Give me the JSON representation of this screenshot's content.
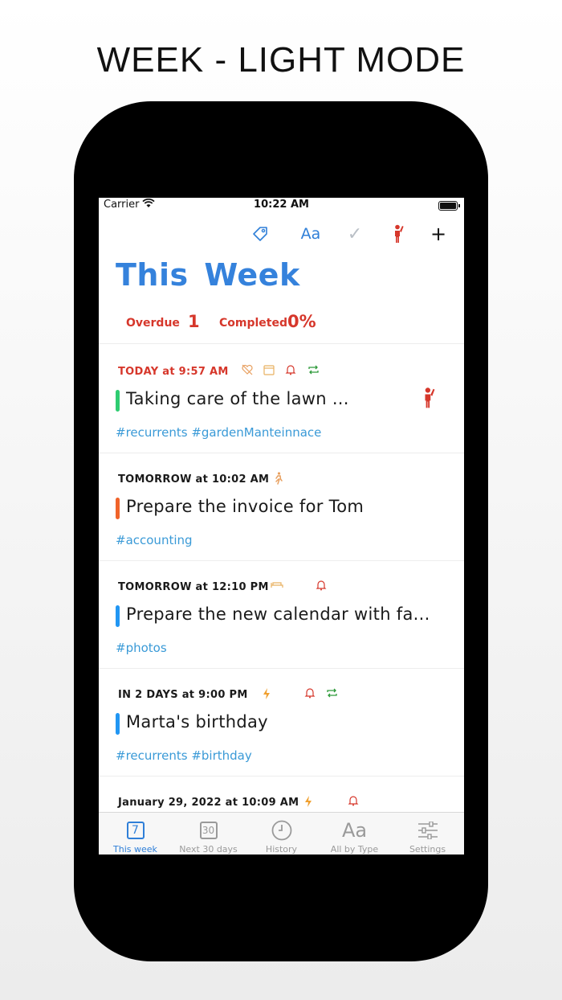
{
  "headline": "WEEK - LIGHT MODE",
  "status_bar": {
    "carrier": "Carrier",
    "time": "10:22 AM"
  },
  "toolbar": {
    "font_label": "Aa",
    "check_label": "✓",
    "plus_label": "+"
  },
  "page_title": "This Week",
  "stats": {
    "overdue_label": "Overdue",
    "overdue_value": "1",
    "completed_label": "Completed",
    "completed_value": "0%"
  },
  "colors": {
    "accent": "#3582dc",
    "overdue_red": "#d6372b",
    "tag_blue": "#3a9ad7",
    "bar_green": "#2ecc71",
    "bar_orange": "#f0632a",
    "bar_blue": "#2196f3"
  },
  "tasks": [
    {
      "when": "TODAY at 9:57 AM",
      "name": "Taking care of the lawn ...",
      "tags": "#recurrents #gardenManteinnace",
      "icons": [
        "heart-off-icon",
        "calendar-icon",
        "bell-icon",
        "repeat-icon"
      ],
      "bar_color": "#2ecc71",
      "overdue": true
    },
    {
      "when": "TOMORROW at 10:02 AM",
      "name": "Prepare the invoice for Tom",
      "tags": "#accounting",
      "icons": [
        "walking-person-icon"
      ],
      "bar_color": "#f0632a"
    },
    {
      "when": "TOMORROW at 12:10 PM",
      "name": "Prepare the new calendar with fa...",
      "tags": "#photos",
      "icons": [
        "bed-icon",
        "bell-icon"
      ],
      "bar_color": "#2196f3"
    },
    {
      "when": "IN 2 DAYS at 9:00 PM",
      "name": "Marta's birthday",
      "tags": "#recurrents #birthday",
      "icons": [
        "bolt-icon",
        "bell-icon",
        "repeat-icon"
      ],
      "bar_color": "#2196f3"
    },
    {
      "when": "January 29, 2022 at 10:09 AM",
      "icons": [
        "bolt-icon",
        "bell-icon"
      ]
    }
  ],
  "tabs": [
    {
      "label": "This week",
      "icon_text": "7",
      "icon": "calendar-7-icon",
      "active": true
    },
    {
      "label": "Next 30 days",
      "icon_text": "30",
      "icon": "calendar-30-icon"
    },
    {
      "label": "History",
      "icon": "clock-icon"
    },
    {
      "label": "All by Type",
      "icon_text": "Aa",
      "icon": "font-type-icon"
    },
    {
      "label": "Settings",
      "icon": "sliders-icon"
    }
  ]
}
